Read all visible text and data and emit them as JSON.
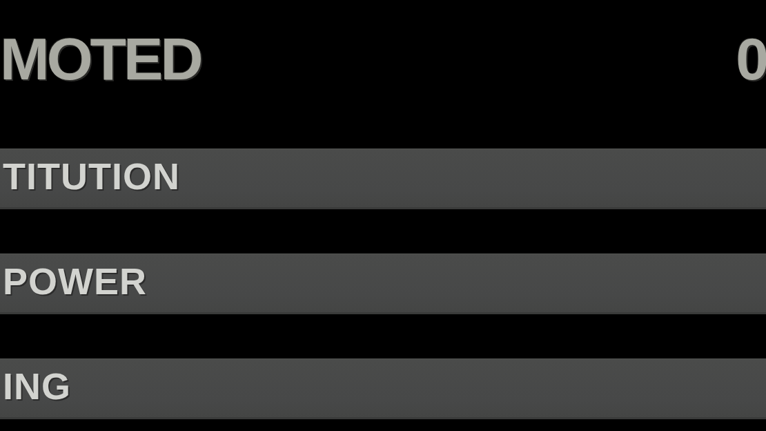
{
  "header": {
    "title": "MOTED",
    "value": "0"
  },
  "rows": [
    {
      "label": "TITUTION"
    },
    {
      "label": "POWER"
    },
    {
      "label": "ING"
    }
  ]
}
